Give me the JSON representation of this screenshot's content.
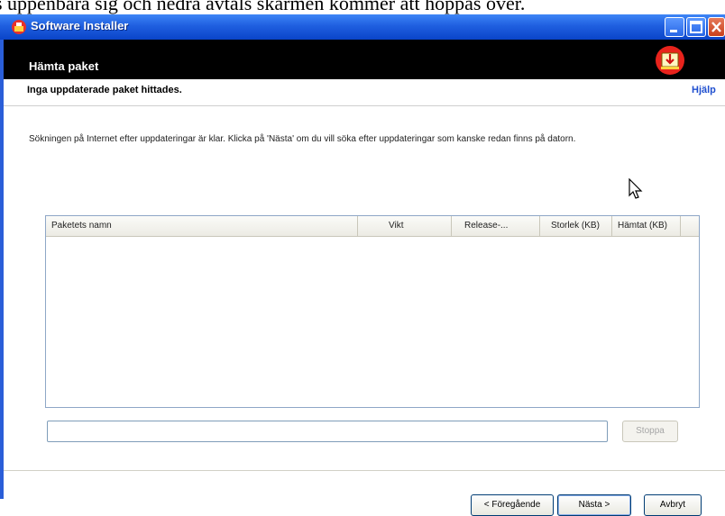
{
  "overlay_caption": "s uppenbara sig och nedra avtals skärmen kommer att hoppas över.",
  "window": {
    "title": "Software Installer",
    "controls": {
      "minimize": "minimize",
      "maximize": "maximize",
      "close": "close"
    }
  },
  "header": {
    "title": "Hämta paket",
    "icon": "download-icon"
  },
  "subtitle": "Inga uppdaterade paket hittades.",
  "help_link": "Hjälp",
  "info_text": "Sökningen på Internet efter uppdateringar är klar. Klicka på 'Nästa' om du vill söka efter uppdateringar som kanske redan finns på datorn.",
  "table": {
    "columns": [
      "Paketets namn",
      "Vikt",
      "Release-...",
      "Storlek (KB)",
      "Hämtat (KB)"
    ],
    "rows": []
  },
  "progress": {
    "value": 0
  },
  "buttons": {
    "stop": "Stoppa",
    "back": "< Föregående",
    "next": "Nästa >",
    "cancel": "Avbryt"
  },
  "colors": {
    "titlebar": "#1f5fe0",
    "header_bg": "#000000",
    "help_link": "#1f4fcf"
  }
}
